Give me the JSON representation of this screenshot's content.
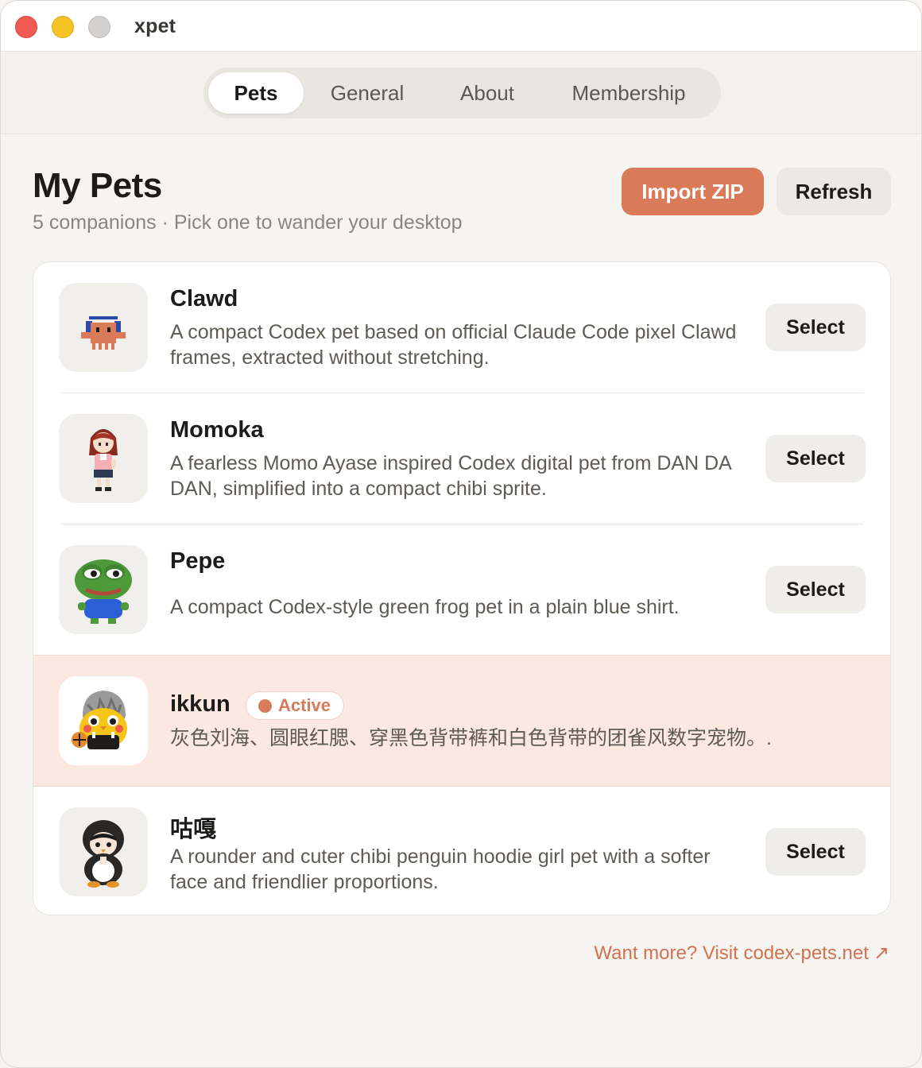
{
  "window": {
    "title": "xpet"
  },
  "tabs": [
    {
      "label": "Pets",
      "active": true
    },
    {
      "label": "General",
      "active": false
    },
    {
      "label": "About",
      "active": false
    },
    {
      "label": "Membership",
      "active": false
    }
  ],
  "header": {
    "title": "My Pets",
    "subtitle": "5 companions · Pick one to wander your desktop",
    "import_label": "Import ZIP",
    "refresh_label": "Refresh"
  },
  "pets": [
    {
      "name": "Clawd",
      "description": "A compact Codex pet based on official Claude Code pixel Clawd frames, extracted without stretching.",
      "action": "Select",
      "icon": "clawd-pixel-icon"
    },
    {
      "name": "Momoka",
      "description": "A fearless Momo Ayase inspired Codex digital pet from DAN DA DAN, simplified into a compact chibi sprite.",
      "action": "Select",
      "icon": "momoka-chibi-icon"
    },
    {
      "name": "Pepe",
      "description": "A compact Codex-style green frog pet in a plain blue shirt.",
      "action": "Select",
      "icon": "pepe-frog-icon"
    },
    {
      "name": "ikkun",
      "description": "灰色刘海、圆眼红腮、穿黑色背带裤和白色背带的团雀风数字宠物。.",
      "badge": "Active",
      "icon": "ikkun-bird-icon"
    },
    {
      "name": "咕嘎",
      "description": "A rounder and cuter chibi penguin hoodie girl pet with a softer face and friendlier proportions.",
      "action": "Select",
      "icon": "penguin-girl-icon"
    }
  ],
  "footer": {
    "link_text": "Want more? Visit codex-pets.net",
    "arrow": "↗"
  },
  "colors": {
    "accent": "#d97a59",
    "active_row": "#fbe8e0",
    "close": "#ef5a52",
    "minimize": "#f6c325",
    "maximize": "#d3d1cf"
  }
}
